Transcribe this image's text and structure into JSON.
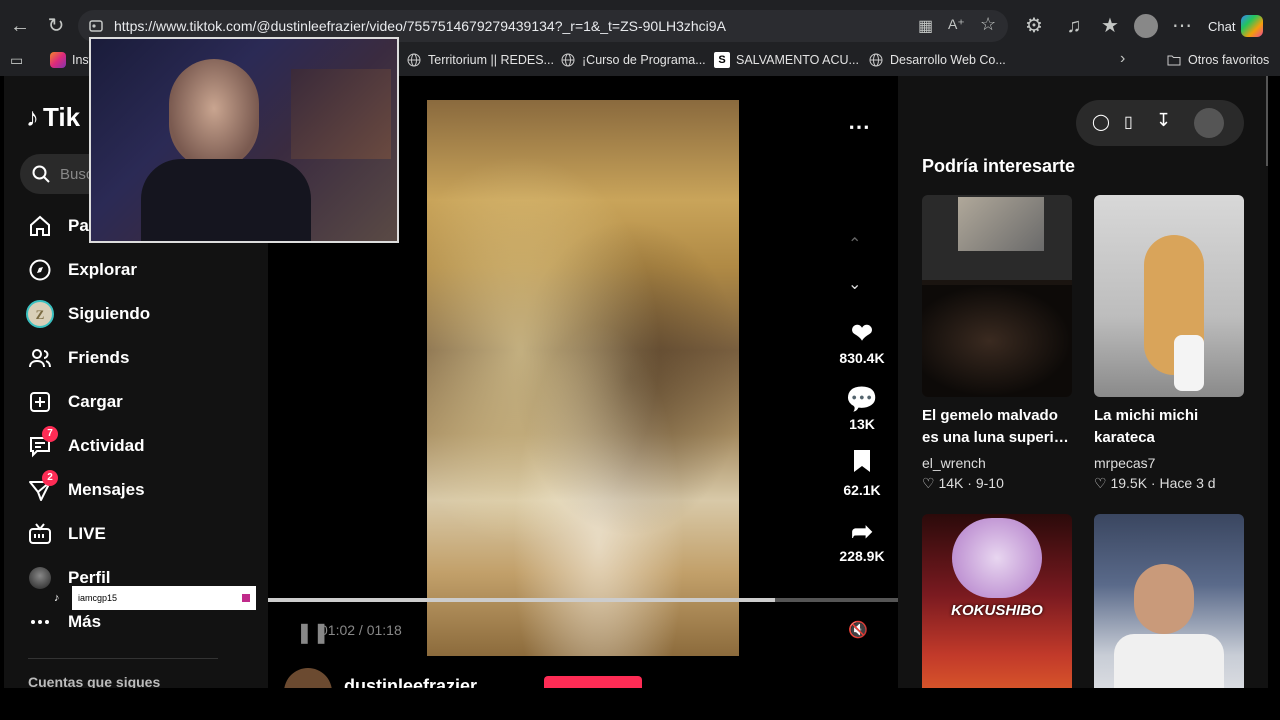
{
  "browser": {
    "url": "https://www.tiktok.com/@dustinleefrazier/video/7557514679279439134?_r=1&_t=ZS-90LH3zhci9A",
    "chat_label": "Chat",
    "bookmarks": [
      "Inst",
      "Territorium || REDES...",
      "¡Curso de Programa...",
      "SALVAMENTO ACU...",
      "Desarrollo Web Co...",
      "Otros favoritos"
    ]
  },
  "sidebar": {
    "logo": "Tik",
    "search_placeholder": "Busc",
    "items": [
      {
        "label": "Par",
        "icon": "home-icon"
      },
      {
        "label": "Explorar",
        "icon": "compass-icon"
      },
      {
        "label": "Siguiendo",
        "icon": "following-icon"
      },
      {
        "label": "Friends",
        "icon": "friends-icon"
      },
      {
        "label": "Cargar",
        "icon": "upload-icon"
      },
      {
        "label": "Actividad",
        "icon": "activity-icon",
        "badge": "7"
      },
      {
        "label": "Mensajes",
        "icon": "messages-icon",
        "badge": "2"
      },
      {
        "label": "LIVE",
        "icon": "live-icon"
      },
      {
        "label": "Perfil",
        "icon": "profile-icon"
      },
      {
        "label": "Más",
        "icon": "more-icon"
      }
    ],
    "following_label": "Cuentas que sigues"
  },
  "video": {
    "likes": "830.4K",
    "comments": "13K",
    "saves": "62.1K",
    "shares": "228.9K",
    "time": "01:02 / 01:18",
    "progress": 0.805,
    "author": "dustinleefrazier"
  },
  "right": {
    "heading": "Podría interesarte",
    "cards": [
      {
        "title1": "El gemelo malvado",
        "title2": "es una luna superio...",
        "author": "el_wrench",
        "likes": "14K",
        "extra": "9-10"
      },
      {
        "title1": "La michi michi",
        "title2": "karateca",
        "author": "mrpecas7",
        "likes": "19.5K",
        "extra": "Hace 3 d"
      },
      {
        "overlay": "KOKUSHIBO"
      },
      {
        "overlay": ""
      }
    ]
  },
  "tooltip": {
    "text": "iamcgp15"
  }
}
